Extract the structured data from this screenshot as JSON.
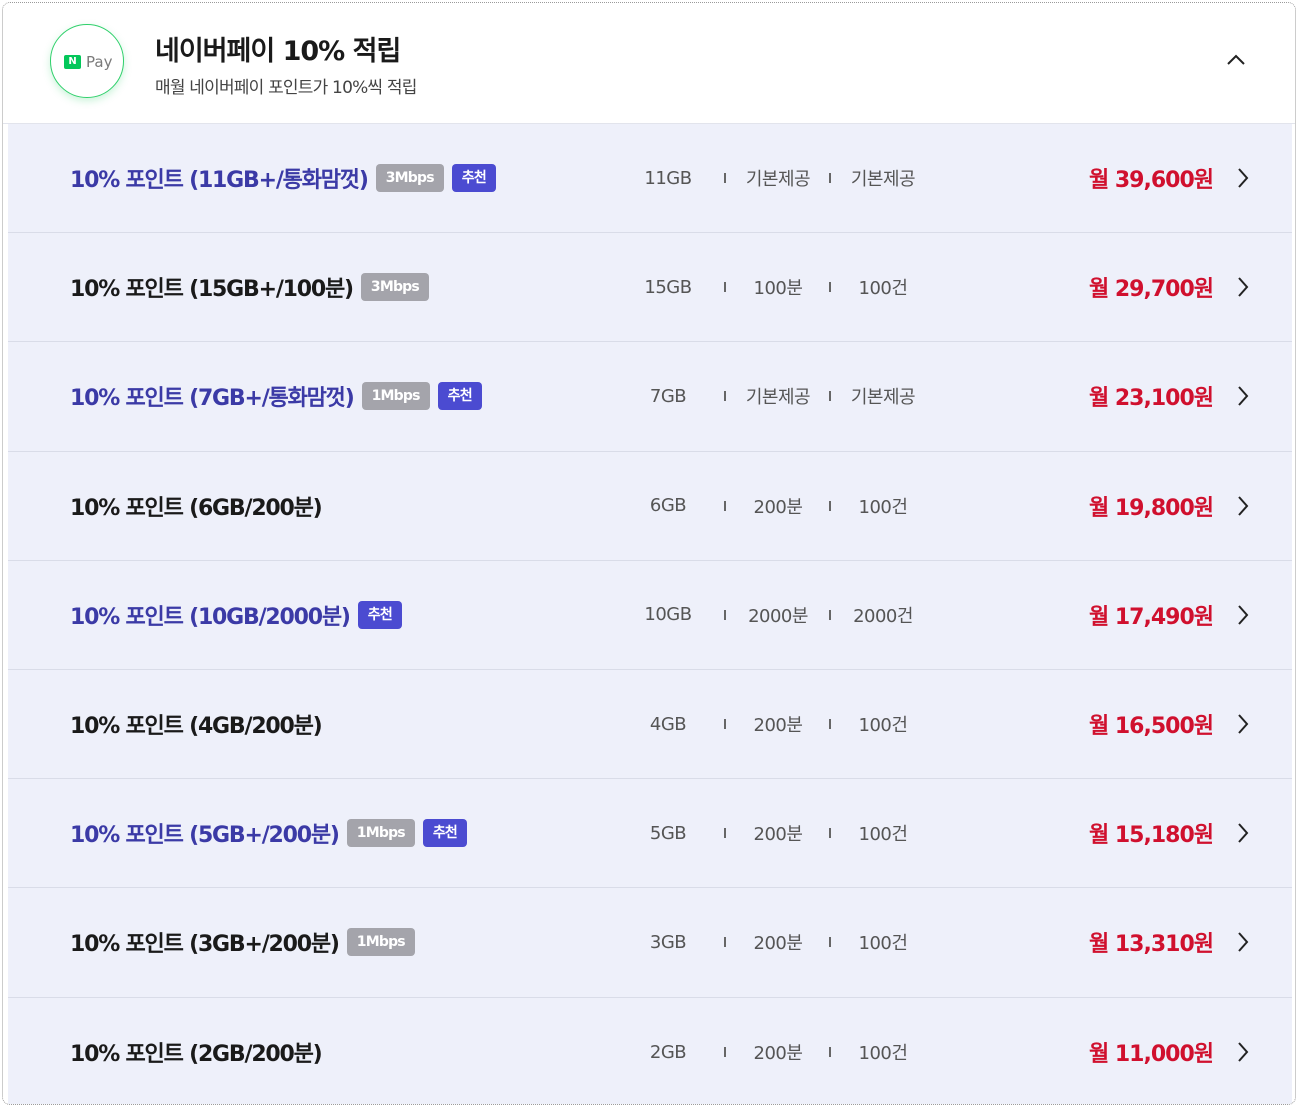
{
  "header": {
    "logo_badge": "N",
    "logo_text": "Pay",
    "title": "네이버페이 10% 적립",
    "subtitle": "매월 네이버페이 포인트가 10%씩 적립"
  },
  "colors": {
    "accent_blue": "#3b3aa6",
    "badge_recommend": "#4b4bd1",
    "badge_speed": "#a4a4ab",
    "price_red": "#d0102e",
    "row_bg": "#eef0fa",
    "naver_green": "#03c75a"
  },
  "plans": [
    {
      "name": "10% 포인트 (11GB+/통화맘껏)",
      "speed": "3Mbps",
      "recommend": "추천",
      "data": "11GB",
      "voice": "기본제공",
      "sms": "기본제공",
      "price": "월 39,600원"
    },
    {
      "name": "10% 포인트 (15GB+/100분)",
      "speed": "3Mbps",
      "recommend": "",
      "data": "15GB",
      "voice": "100분",
      "sms": "100건",
      "price": "월 29,700원"
    },
    {
      "name": "10% 포인트 (7GB+/통화맘껏)",
      "speed": "1Mbps",
      "recommend": "추천",
      "data": "7GB",
      "voice": "기본제공",
      "sms": "기본제공",
      "price": "월 23,100원"
    },
    {
      "name": "10% 포인트 (6GB/200분)",
      "speed": "",
      "recommend": "",
      "data": "6GB",
      "voice": "200분",
      "sms": "100건",
      "price": "월 19,800원"
    },
    {
      "name": "10% 포인트 (10GB/2000분)",
      "speed": "",
      "recommend": "추천",
      "data": "10GB",
      "voice": "2000분",
      "sms": "2000건",
      "price": "월 17,490원"
    },
    {
      "name": "10% 포인트 (4GB/200분)",
      "speed": "",
      "recommend": "",
      "data": "4GB",
      "voice": "200분",
      "sms": "100건",
      "price": "월 16,500원"
    },
    {
      "name": "10% 포인트 (5GB+/200분)",
      "speed": "1Mbps",
      "recommend": "추천",
      "data": "5GB",
      "voice": "200분",
      "sms": "100건",
      "price": "월 15,180원"
    },
    {
      "name": "10% 포인트 (3GB+/200분)",
      "speed": "1Mbps",
      "recommend": "",
      "data": "3GB",
      "voice": "200분",
      "sms": "100건",
      "price": "월 13,310원"
    },
    {
      "name": "10% 포인트 (2GB/200분)",
      "speed": "",
      "recommend": "",
      "data": "2GB",
      "voice": "200분",
      "sms": "100건",
      "price": "월 11,000원"
    }
  ]
}
